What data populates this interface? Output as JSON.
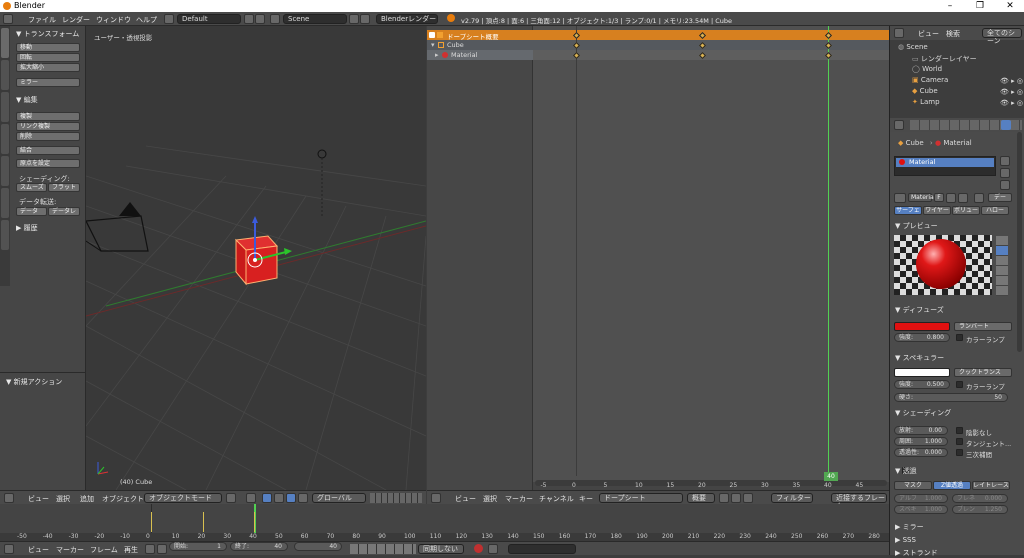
{
  "window": {
    "title": "Blender",
    "controls": [
      "–",
      "❐",
      "✕"
    ]
  },
  "info_header": {
    "menus": [
      "ファイル",
      "レンダー",
      "ウィンドウ",
      "ヘルプ"
    ],
    "layout": "Default",
    "scene": "Scene",
    "engine": "Blenderレンダー",
    "stats": "v2.79 | 頂点:8 | 面:6 | 三角面:12 | オブジェクト:1/3 | ランプ:0/1 | メモリ:23.54M | Cube"
  },
  "toolshelf": {
    "tabs": [
      "ツール",
      "作成",
      "関係",
      "アニメーション",
      "物理演算",
      "Grease Pencil",
      "Create Clay"
    ],
    "transform_header": "▼ トランスフォーム",
    "transform_buttons": [
      "移動",
      "回転",
      "拡大縮小"
    ],
    "mirror_button": "ミラー",
    "edit_header": "▼ 編集",
    "edit_buttons": [
      "複製",
      "リンク複製",
      "削除"
    ],
    "join_button": "結合",
    "origin_button": "原点を設定",
    "shading_label": "シェーディング:",
    "smooth": "スムーズ",
    "flat": "フラット",
    "data_transfer_label": "データ転送:",
    "data": "データ",
    "data_layers": "データレ",
    "history": "▶ 履歴",
    "operator_header": "▼ 新規アクション"
  },
  "viewport": {
    "label": "ユーザー・透視投影",
    "object_label": "(40) Cube"
  },
  "view3d_header": {
    "menus": [
      "ビュー",
      "選択",
      "追加",
      "オブジェクト"
    ],
    "mode": "オブジェクトモード",
    "orientation": "グローバル"
  },
  "dopesheet": {
    "channels": [
      {
        "name": "ドープシート概要",
        "type": "summary"
      },
      {
        "name": "Cube",
        "type": "object"
      },
      {
        "name": "Material",
        "type": "material"
      }
    ],
    "keyframes": [
      0,
      20,
      40
    ],
    "ruler": [
      "-5",
      "0",
      "5",
      "10",
      "15",
      "20",
      "25",
      "30",
      "35",
      "40",
      "45"
    ],
    "current_frame": "40",
    "menus": [
      "ビュー",
      "選択",
      "マーカー",
      "チャンネル",
      "キー"
    ],
    "mode": "ドープシート",
    "summary": "概要",
    "filter": "フィルター",
    "nearest": "近接するフレーム"
  },
  "timeline": {
    "ruler": [
      "-50",
      "-40",
      "-30",
      "-20",
      "-10",
      "0",
      "10",
      "20",
      "30",
      "40",
      "50",
      "60",
      "70",
      "80",
      "90",
      "100",
      "110",
      "120",
      "130",
      "140",
      "150",
      "160",
      "170",
      "180",
      "190",
      "200",
      "210",
      "220",
      "230",
      "240",
      "250",
      "260",
      "270",
      "280"
    ],
    "menus": [
      "ビュー",
      "マーカー",
      "フレーム",
      "再生"
    ],
    "start_label": "開始:",
    "start": "1",
    "end_label": "終了:",
    "end": "40",
    "current": "40",
    "sync": "同期しない"
  },
  "outliner": {
    "menus": [
      "ビュー",
      "検索"
    ],
    "filter": "全てのシーン",
    "items": [
      "Scene",
      "レンダーレイヤー",
      "World",
      "Camera",
      "Cube",
      "Lamp"
    ]
  },
  "properties": {
    "breadcrumb": [
      "Cube",
      "Material"
    ],
    "slot": "Material",
    "material_name": "Material",
    "mat_count": "F",
    "data_btn": "デー",
    "tabs": [
      "サーフェ",
      "ワイヤー",
      "ボリュー",
      "ハロー"
    ],
    "preview": "▼ プレビュー",
    "diffuse": "▼ ディフューズ",
    "diffuse_shader": "ランバート",
    "diffuse_intensity_label": "強度:",
    "diffuse_intensity": "0.800",
    "ramp": "カラーランプ",
    "specular": "▼ スペキュラー",
    "specular_shader": "クックトランス",
    "spec_intensity_label": "強度:",
    "spec_intensity": "0.500",
    "spec_ramp": "カラーランプ",
    "hardness_label": "硬さ:",
    "hardness": "50",
    "shading": "▼ シェーディング",
    "emit_label": "放射:",
    "emit": "0.00",
    "ambient_label": "周囲:",
    "ambient": "1.000",
    "translucency_label": "透過性:",
    "translucency": "0.000",
    "shadeless": "陰影なし",
    "tangent": "タンジェント...",
    "cubic": "三次補間",
    "transparency": "▼ 透過",
    "mask": "マスク",
    "ztransp": "Z値透過",
    "raytrace": "レイトレース",
    "alpha_label": "アルフ",
    "alpha": "1.000",
    "fresnel_label": "フレネ",
    "fresnel": "0.000",
    "spec_t_label": "スペキ",
    "spec_t": "1.000",
    "blend_label": "ブレン",
    "blend": "1.250",
    "mirror": "▶ ミラー",
    "sss": "▶ SSS",
    "strand": "▶ ストランド",
    "colors": {
      "diffuse": "#e01010",
      "specular": "#ffffff",
      "accent": "#5680c2"
    }
  }
}
